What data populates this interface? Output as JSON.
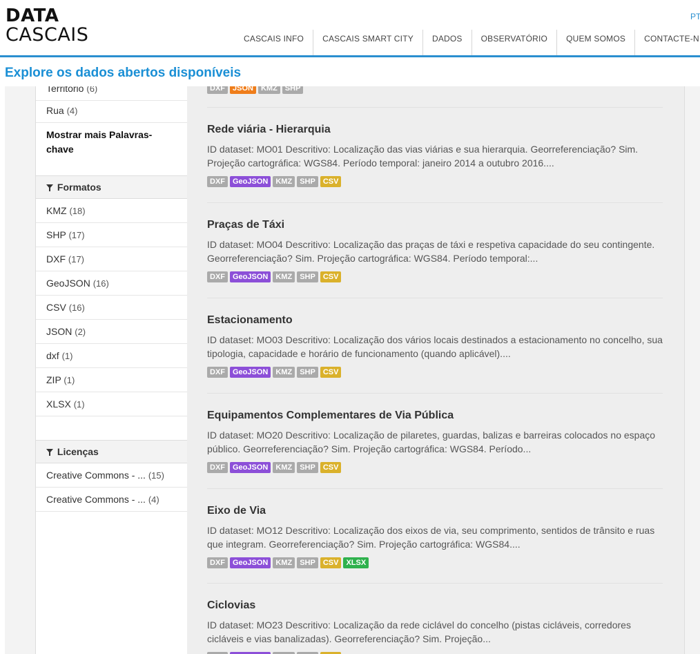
{
  "header": {
    "logo_line1": "DATA",
    "logo_line2": "CASCAIS",
    "lang": "PT",
    "nav": [
      "CASCAIS INFO",
      "CASCAIS SMART CITY",
      "DADOS",
      "OBSERVATÓRIO",
      "QUEM SOMOS",
      "CONTACTE-N"
    ]
  },
  "page_title": "Explore os dados abertos disponíveis",
  "sidebar": {
    "keywords": [
      {
        "label": "Território",
        "count": "(6)"
      },
      {
        "label": "Rua",
        "count": "(4)"
      }
    ],
    "more_keywords": "Mostrar mais Palavras-chave",
    "formats_title": "Formatos",
    "formats": [
      {
        "label": "KMZ",
        "count": "(18)"
      },
      {
        "label": "SHP",
        "count": "(17)"
      },
      {
        "label": "DXF",
        "count": "(17)"
      },
      {
        "label": "GeoJSON",
        "count": "(16)"
      },
      {
        "label": "CSV",
        "count": "(16)"
      },
      {
        "label": "JSON",
        "count": "(2)"
      },
      {
        "label": "dxf",
        "count": "(1)"
      },
      {
        "label": "ZIP",
        "count": "(1)"
      },
      {
        "label": "XLSX",
        "count": "(1)"
      }
    ],
    "licenses_title": "Licenças",
    "licenses": [
      {
        "label": "Creative Commons - ...",
        "count": "(15)"
      },
      {
        "label": "Creative Commons - ...",
        "count": "(4)"
      }
    ]
  },
  "badge_colors": {
    "DXF": "#aaaaaa",
    "JSON": "#ef7d1a",
    "KMZ": "#aaaaaa",
    "SHP": "#aaaaaa",
    "GeoJSON": "#8c4fd8",
    "CSV": "#dab12b",
    "XLSX": "#2fb14d"
  },
  "top_badges": [
    "DXF",
    "JSON",
    "KMZ",
    "SHP"
  ],
  "datasets": [
    {
      "title": "Rede viária - Hierarquia",
      "desc_line1": "ID dataset: MO01 Descritivo: Localização das vias viárias e sua hierarquia. Georreferenciação? Sim.",
      "desc_line2": "Projeção cartográfica: WGS84. Período temporal: janeiro 2014 a outubro 2016....",
      "badges": [
        "DXF",
        "GeoJSON",
        "KMZ",
        "SHP",
        "CSV"
      ]
    },
    {
      "title": "Praças de Táxi",
      "desc_line1": "ID dataset: MO04 Descritivo: Localização das praças de táxi e respetiva capacidade do seu contingente.",
      "desc_line2": "Georreferenciação? Sim. Projeção cartográfica: WGS84. Período temporal:...",
      "badges": [
        "DXF",
        "GeoJSON",
        "KMZ",
        "SHP",
        "CSV"
      ]
    },
    {
      "title": "Estacionamento",
      "desc_line1": "ID dataset: MO03 Descritivo: Localização dos vários locais destinados a estacionamento no concelho, sua",
      "desc_line2": "tipologia, capacidade e horário de funcionamento (quando aplicável)....",
      "badges": [
        "DXF",
        "GeoJSON",
        "KMZ",
        "SHP",
        "CSV"
      ]
    },
    {
      "title": "Equipamentos Complementares de Via Pública",
      "desc_line1": "ID dataset: MO20 Descritivo: Localização de pilaretes, guardas, balizas e barreiras colocados no espaço",
      "desc_line2": "público. Georreferenciação? Sim. Projeção cartográfica: WGS84. Período...",
      "badges": [
        "DXF",
        "GeoJSON",
        "KMZ",
        "SHP",
        "CSV"
      ]
    },
    {
      "title": "Eixo de Via",
      "desc_line1": "ID dataset: MO12 Descritivo: Localização dos eixos de via, seu comprimento, sentidos de trânsito e ruas",
      "desc_line2": "que integram. Georreferenciação? Sim. Projeção cartográfica: WGS84....",
      "badges": [
        "DXF",
        "GeoJSON",
        "KMZ",
        "SHP",
        "CSV",
        "XLSX"
      ]
    },
    {
      "title": "Ciclovias",
      "desc_line1": "ID dataset: MO23 Descritivo: Localização da rede ciclável do concelho (pistas cicláveis, corredores",
      "desc_line2": "cicláveis e vias banalizadas). Georreferenciação? Sim. Projeção...",
      "badges": [
        "DXF",
        "GeoJSON",
        "KMZ",
        "SHP",
        "CSV"
      ]
    }
  ]
}
